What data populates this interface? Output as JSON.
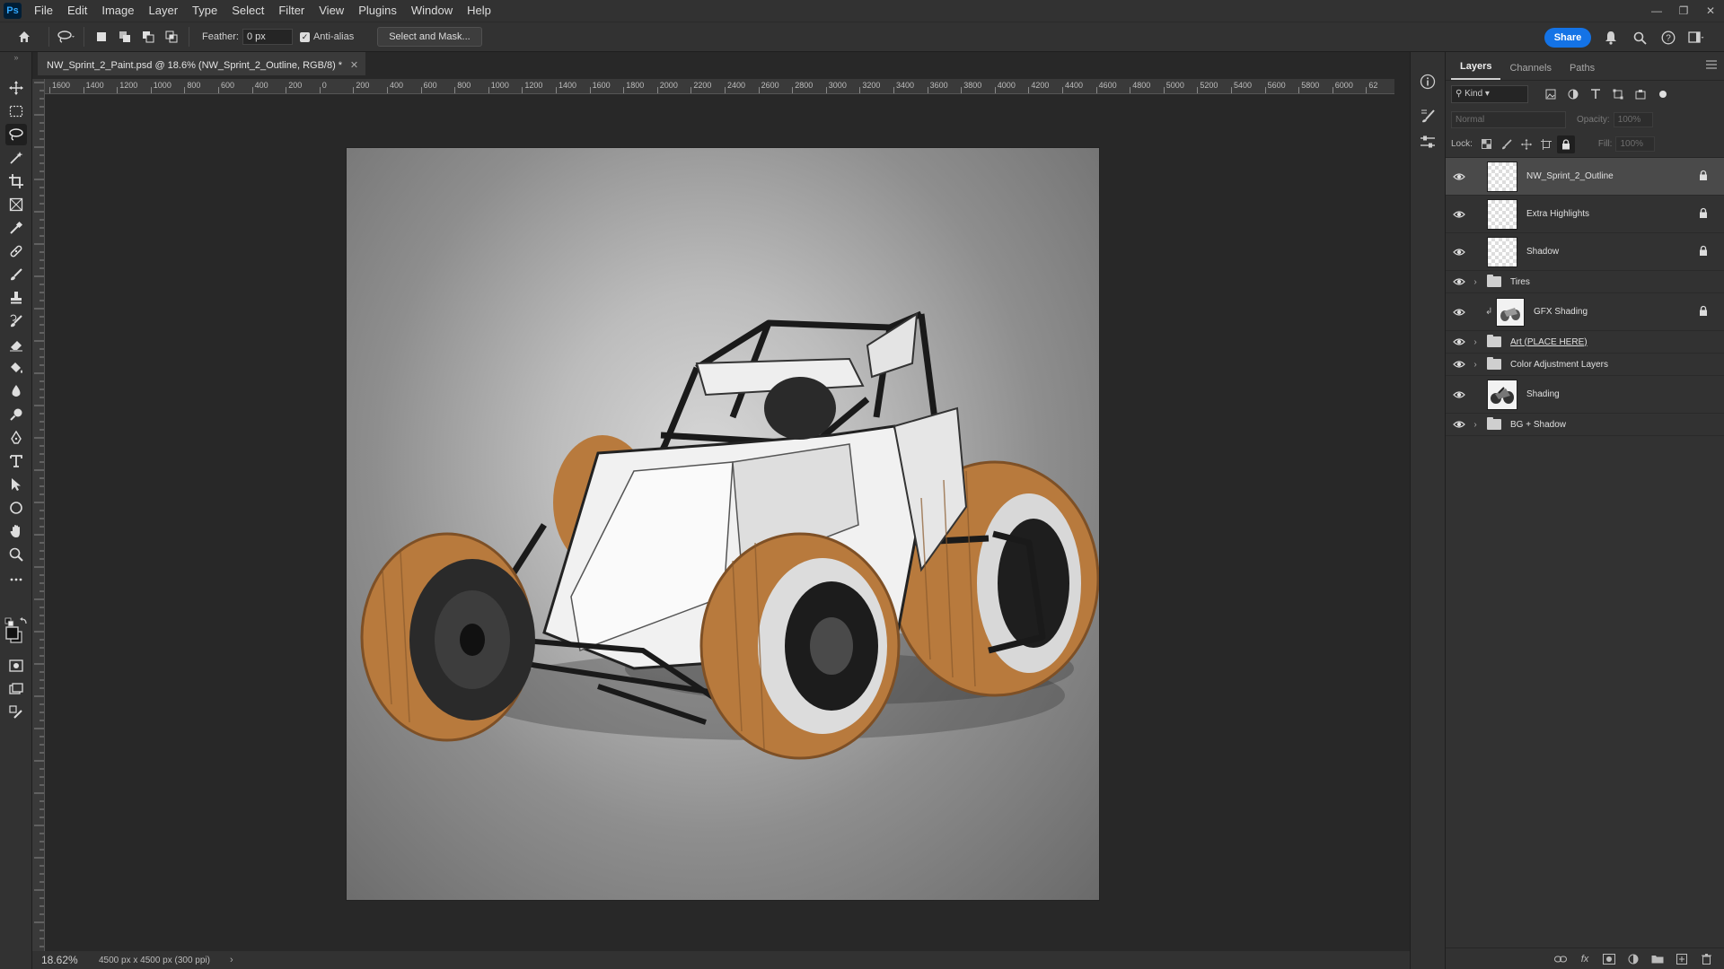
{
  "app": {
    "logo_text": "Ps"
  },
  "menu": [
    "File",
    "Edit",
    "Image",
    "Layer",
    "Type",
    "Select",
    "Filter",
    "View",
    "Plugins",
    "Window",
    "Help"
  ],
  "options": {
    "feather_label": "Feather:",
    "feather_value": "0 px",
    "antialias_label": "Anti-alias",
    "antialias_checked": true,
    "select_mask_label": "Select and Mask...",
    "share_label": "Share"
  },
  "document": {
    "tab_title": "NW_Sprint_2_Paint.psd @ 18.6% (NW_Sprint_2_Outline, RGB/8) *",
    "ruler_labels": [
      "1600",
      "1400",
      "1200",
      "1000",
      "800",
      "600",
      "400",
      "200",
      "0",
      "200",
      "400",
      "600",
      "800",
      "1000",
      "1200",
      "1400",
      "1600",
      "1800",
      "2000",
      "2200",
      "2400",
      "2600",
      "2800",
      "3000",
      "3200",
      "3400",
      "3600",
      "3800",
      "4000",
      "4200",
      "4400",
      "4600",
      "4800",
      "5000",
      "5200",
      "5400",
      "5600",
      "5800",
      "6000",
      "62"
    ]
  },
  "status": {
    "zoom": "18.62%",
    "doc_size": "4500 px x 4500 px (300 ppi)"
  },
  "layers_panel": {
    "tabs": [
      "Layers",
      "Channels",
      "Paths"
    ],
    "kind_label": "Kind",
    "blend_mode": "Normal",
    "opacity_label": "Opacity:",
    "opacity_value": "100%",
    "lock_label": "Lock:",
    "fill_label": "Fill:",
    "fill_value": "100%",
    "layers": [
      {
        "name": "NW_Sprint_2_Outline",
        "type": "pixel",
        "locked": true,
        "selected": true
      },
      {
        "name": "Extra Highlights",
        "type": "pixel",
        "locked": true
      },
      {
        "name": "Shadow",
        "type": "pixel",
        "locked": true
      },
      {
        "name": "Tires",
        "type": "group"
      },
      {
        "name": "GFX Shading",
        "type": "art",
        "locked": true,
        "clipped": true
      },
      {
        "name": "Art (PLACE HERE)",
        "type": "group",
        "underlined": true
      },
      {
        "name": "Color Adjustment Layers",
        "type": "group"
      },
      {
        "name": "Shading",
        "type": "art"
      },
      {
        "name": "BG + Shadow",
        "type": "group"
      }
    ]
  },
  "colors": {
    "accent": "#1473e6",
    "panel_bg": "#323232",
    "canvas_bg": "#282828",
    "tire": "#b87a3d"
  }
}
